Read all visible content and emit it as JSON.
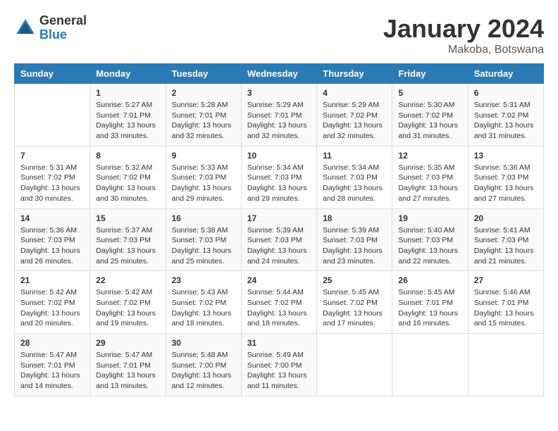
{
  "header": {
    "logo_general": "General",
    "logo_blue": "Blue",
    "month_title": "January 2024",
    "location": "Makoba, Botswana"
  },
  "calendar": {
    "days_of_week": [
      "Sunday",
      "Monday",
      "Tuesday",
      "Wednesday",
      "Thursday",
      "Friday",
      "Saturday"
    ],
    "weeks": [
      [
        {
          "day": "",
          "info": ""
        },
        {
          "day": "1",
          "info": "Sunrise: 5:27 AM\nSunset: 7:01 PM\nDaylight: 13 hours\nand 33 minutes."
        },
        {
          "day": "2",
          "info": "Sunrise: 5:28 AM\nSunset: 7:01 PM\nDaylight: 13 hours\nand 32 minutes."
        },
        {
          "day": "3",
          "info": "Sunrise: 5:29 AM\nSunset: 7:01 PM\nDaylight: 13 hours\nand 32 minutes."
        },
        {
          "day": "4",
          "info": "Sunrise: 5:29 AM\nSunset: 7:02 PM\nDaylight: 13 hours\nand 32 minutes."
        },
        {
          "day": "5",
          "info": "Sunrise: 5:30 AM\nSunset: 7:02 PM\nDaylight: 13 hours\nand 31 minutes."
        },
        {
          "day": "6",
          "info": "Sunrise: 5:31 AM\nSunset: 7:02 PM\nDaylight: 13 hours\nand 31 minutes."
        }
      ],
      [
        {
          "day": "7",
          "info": "Sunrise: 5:31 AM\nSunset: 7:02 PM\nDaylight: 13 hours\nand 30 minutes."
        },
        {
          "day": "8",
          "info": "Sunrise: 5:32 AM\nSunset: 7:02 PM\nDaylight: 13 hours\nand 30 minutes."
        },
        {
          "day": "9",
          "info": "Sunrise: 5:33 AM\nSunset: 7:03 PM\nDaylight: 13 hours\nand 29 minutes."
        },
        {
          "day": "10",
          "info": "Sunrise: 5:34 AM\nSunset: 7:03 PM\nDaylight: 13 hours\nand 29 minutes."
        },
        {
          "day": "11",
          "info": "Sunrise: 5:34 AM\nSunset: 7:03 PM\nDaylight: 13 hours\nand 28 minutes."
        },
        {
          "day": "12",
          "info": "Sunrise: 5:35 AM\nSunset: 7:03 PM\nDaylight: 13 hours\nand 27 minutes."
        },
        {
          "day": "13",
          "info": "Sunrise: 5:36 AM\nSunset: 7:03 PM\nDaylight: 13 hours\nand 27 minutes."
        }
      ],
      [
        {
          "day": "14",
          "info": "Sunrise: 5:36 AM\nSunset: 7:03 PM\nDaylight: 13 hours\nand 26 minutes."
        },
        {
          "day": "15",
          "info": "Sunrise: 5:37 AM\nSunset: 7:03 PM\nDaylight: 13 hours\nand 25 minutes."
        },
        {
          "day": "16",
          "info": "Sunrise: 5:38 AM\nSunset: 7:03 PM\nDaylight: 13 hours\nand 25 minutes."
        },
        {
          "day": "17",
          "info": "Sunrise: 5:39 AM\nSunset: 7:03 PM\nDaylight: 13 hours\nand 24 minutes."
        },
        {
          "day": "18",
          "info": "Sunrise: 5:39 AM\nSunset: 7:03 PM\nDaylight: 13 hours\nand 23 minutes."
        },
        {
          "day": "19",
          "info": "Sunrise: 5:40 AM\nSunset: 7:03 PM\nDaylight: 13 hours\nand 22 minutes."
        },
        {
          "day": "20",
          "info": "Sunrise: 5:41 AM\nSunset: 7:03 PM\nDaylight: 13 hours\nand 21 minutes."
        }
      ],
      [
        {
          "day": "21",
          "info": "Sunrise: 5:42 AM\nSunset: 7:02 PM\nDaylight: 13 hours\nand 20 minutes."
        },
        {
          "day": "22",
          "info": "Sunrise: 5:42 AM\nSunset: 7:02 PM\nDaylight: 13 hours\nand 19 minutes."
        },
        {
          "day": "23",
          "info": "Sunrise: 5:43 AM\nSunset: 7:02 PM\nDaylight: 13 hours\nand 18 minutes."
        },
        {
          "day": "24",
          "info": "Sunrise: 5:44 AM\nSunset: 7:02 PM\nDaylight: 13 hours\nand 18 minutes."
        },
        {
          "day": "25",
          "info": "Sunrise: 5:45 AM\nSunset: 7:02 PM\nDaylight: 13 hours\nand 17 minutes."
        },
        {
          "day": "26",
          "info": "Sunrise: 5:45 AM\nSunset: 7:01 PM\nDaylight: 13 hours\nand 16 minutes."
        },
        {
          "day": "27",
          "info": "Sunrise: 5:46 AM\nSunset: 7:01 PM\nDaylight: 13 hours\nand 15 minutes."
        }
      ],
      [
        {
          "day": "28",
          "info": "Sunrise: 5:47 AM\nSunset: 7:01 PM\nDaylight: 13 hours\nand 14 minutes."
        },
        {
          "day": "29",
          "info": "Sunrise: 5:47 AM\nSunset: 7:01 PM\nDaylight: 13 hours\nand 13 minutes."
        },
        {
          "day": "30",
          "info": "Sunrise: 5:48 AM\nSunset: 7:00 PM\nDaylight: 13 hours\nand 12 minutes."
        },
        {
          "day": "31",
          "info": "Sunrise: 5:49 AM\nSunset: 7:00 PM\nDaylight: 13 hours\nand 11 minutes."
        },
        {
          "day": "",
          "info": ""
        },
        {
          "day": "",
          "info": ""
        },
        {
          "day": "",
          "info": ""
        }
      ]
    ]
  }
}
